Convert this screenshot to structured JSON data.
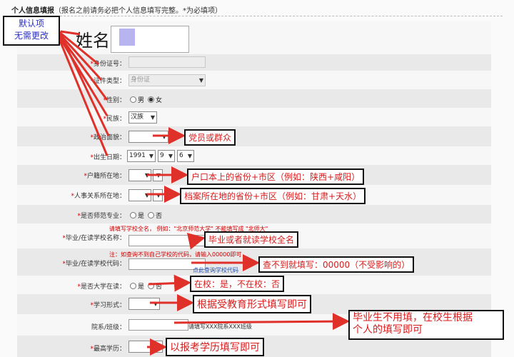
{
  "header": {
    "title": "个人信息填报",
    "note": "（报名之前请务必把个人信息填写完整。*为必填项）"
  },
  "form": {
    "name_label": "姓名：",
    "id_label": "身份证号：",
    "id_type_label": "证件类型：",
    "id_type_value": "身份证",
    "gender_label": "性别：",
    "gender_male": "男",
    "gender_female": "女",
    "ethnicity_label": "民族：",
    "ethnicity_value": "汉族",
    "political_label": "政治面貌：",
    "birth_label": "出生日期：",
    "birth_year": "1991",
    "birth_month": "9",
    "birth_day": "6",
    "hukou_label": "户籍所在地：",
    "archive_label": "人事关系所在地：",
    "normal_label": "是否师范专业：",
    "yes": "是",
    "no": "否",
    "school_name_label": "毕业/在读学校名称：",
    "school_name_hint": "请填写学校全名，  例如：\"北京师范大学\" 不能填写成 \"北师大\"",
    "school_code_label": "毕业/在读学校代码：",
    "school_code_hint": "注：如查询不到自己学校的代码，请输入00000即可",
    "school_code_link": "点此查询学校代码",
    "in_school_label": "是否大学在读：",
    "study_form_label": "学习形式：",
    "dept_label": "院系/班级：",
    "dept_note": "请填写XXX院系XXX班级",
    "degree_label": "最高学历："
  },
  "annotations": {
    "default_note_line1": "默认项",
    "default_note_line2": "无需更改",
    "political": "党员或群众",
    "hukou": "户口本上的省份+市区（例如：陕西+咸阳）",
    "archive": "档案所在地的省份+市区（例如：甘肃+天水）",
    "school_name": "毕业或者就读学校全名",
    "school_code": "查不到就填写：00000（不受影响的）",
    "in_school": "在校：是，不在校：否",
    "study_form": "根据受教育形式填写即可",
    "dept_line1": "毕业生不用填，在校生根据",
    "dept_line2": "个人的填写即可",
    "degree": "以报考学历填写即可"
  },
  "colors": {
    "annotation_text": "#d91a1a",
    "annotation_text_blue": "#2b2fc8",
    "arrow": "#e0302a",
    "required": "#dd0000",
    "link": "#1a4fb5"
  }
}
